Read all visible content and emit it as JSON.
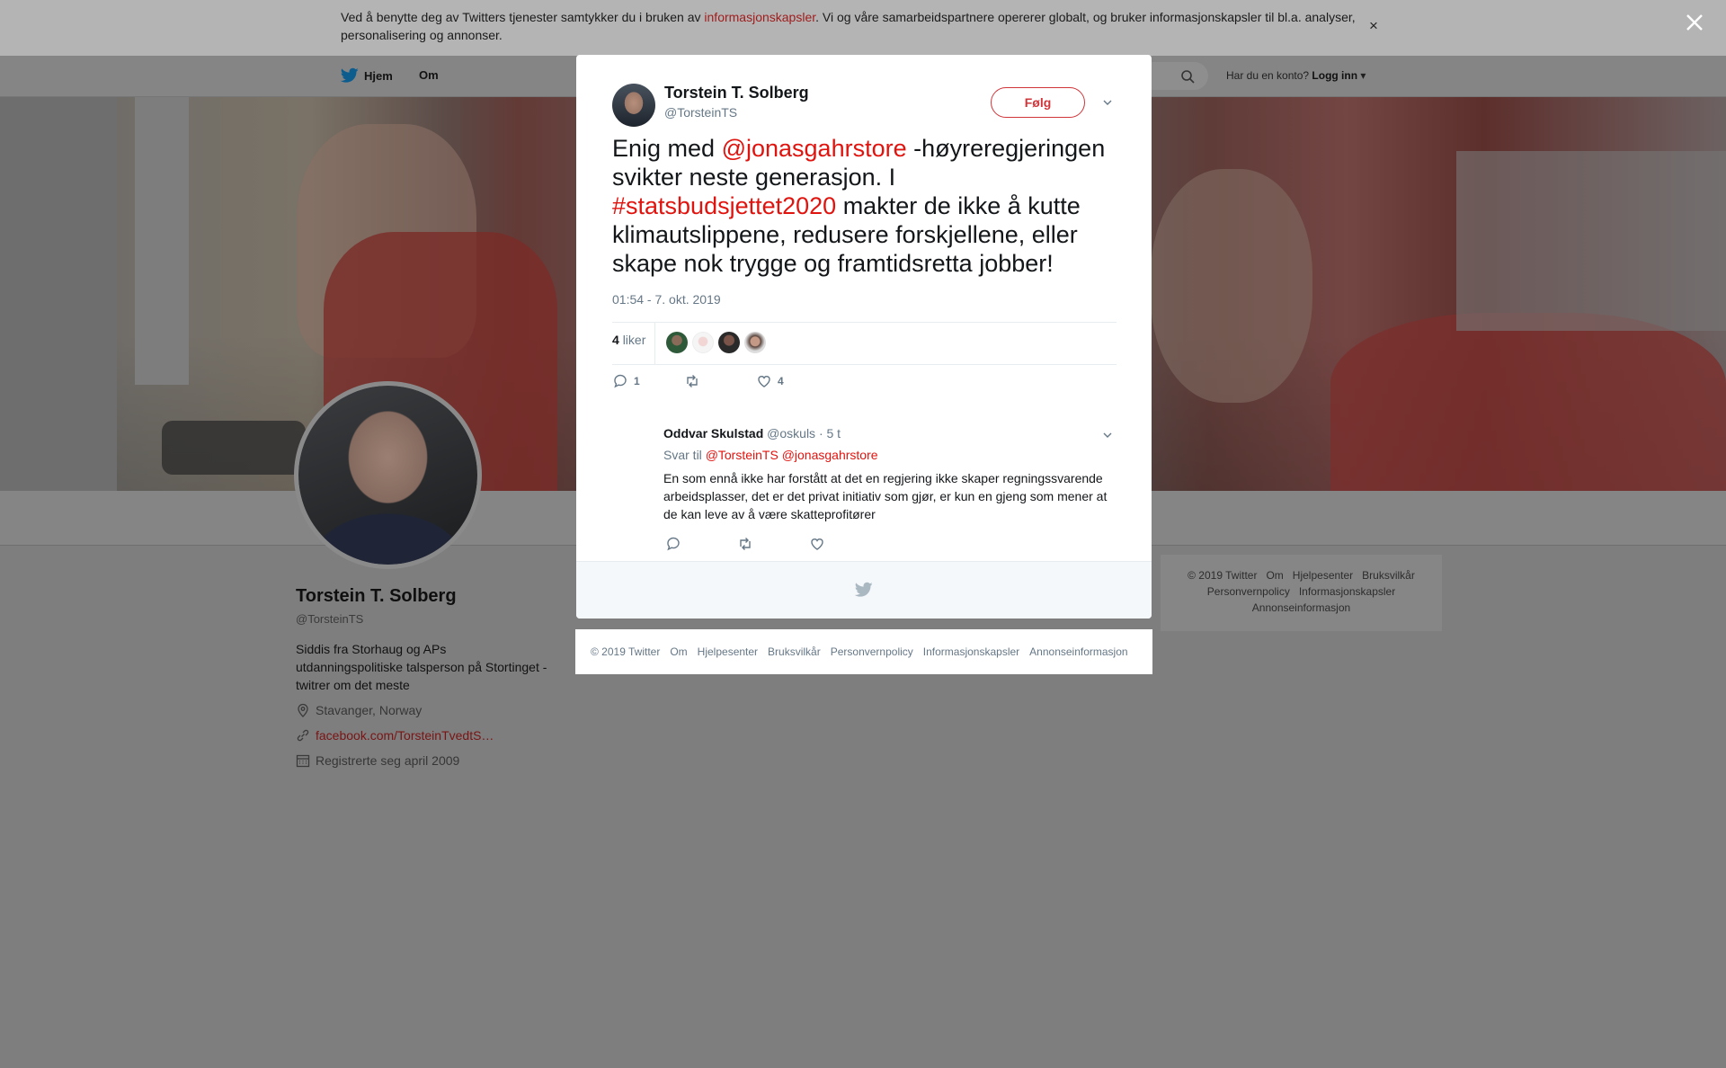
{
  "cookie_bar": {
    "text_before": "Ved å benytte deg av Twitters tjenester samtykker du i bruken av ",
    "link": "informasjonskapsler",
    "text_after": ". Vi og våre samarbeidspartnere opererer globalt, og bruker informasjonskapsler til bl.a. analyser, personalisering og annonser.",
    "close": "×"
  },
  "nav": {
    "home": "Hjem",
    "about": "Om",
    "login_prompt": "Har du en konto?",
    "login": "Logg inn"
  },
  "profile": {
    "name": "Torstein T. Solberg",
    "handle": "@TorsteinTS",
    "bio": "Siddis fra Storhaug og APs utdanningspolitiske talsperson på Stortinget - twitrer om det meste",
    "location": "Stavanger, Norway",
    "link": "facebook.com/TorsteinTvedtS…",
    "joined": "Registrerte seg april 2009"
  },
  "tweet": {
    "author_name": "Torstein T. Solberg",
    "author_handle": "@TorsteinTS",
    "follow_label": "Følg",
    "text_1": "Enig med ",
    "mention": "@jonasgahrstore",
    "text_2": " -høyreregjeringen svikter neste generasjon. I ",
    "hashtag": "#statsbudsjettet2020",
    "text_3": " makter de ikke å kutte klimautslippene, redusere forskjellene, eller skape nok trygge og framtidsretta jobber!",
    "timestamp": "01:54 - 7. okt. 2019",
    "likes_count": "4",
    "likes_label": "liker",
    "reply_count": "1",
    "like_count": "4"
  },
  "reply": {
    "name": "Oddvar Skulstad",
    "handle": "@oskuls",
    "time": "· 5 t",
    "reply_to_label": "Svar til",
    "reply_to_1": "@TorsteinTS",
    "reply_to_2": "@jonasgahrstore",
    "text": "En som ennå ikke har forstått at det en regjering ikke skaper regningssvarende arbeidsplasser, det er det privat initiativ som gjør, er kun en gjeng som mener at de kan leve av å være skatteprofitører"
  },
  "footer": {
    "items": [
      "© 2019 Twitter",
      "Om",
      "Hjelpesenter",
      "Bruksvilkår",
      "Personvernpolicy",
      "Informasjonskapsler",
      "Annonseinformasjon"
    ]
  },
  "colors": {
    "accent": "#e0140f",
    "overlay": "#7e7e7e"
  }
}
